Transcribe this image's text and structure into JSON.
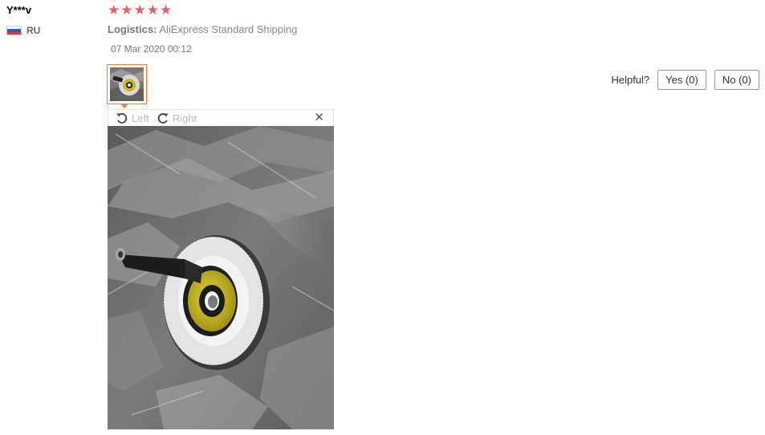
{
  "review": {
    "user_name": "Y***v",
    "country_code": "RU",
    "stars": [
      "★",
      "★",
      "★",
      "★",
      "★"
    ],
    "rating": 5,
    "logistics_label": "Logistics:",
    "logistics_value": "AliExpress Standard Shipping",
    "date": "07 Mar 2020 00:12"
  },
  "viewer": {
    "rotate_left_label": "Left",
    "rotate_right_label": "Right",
    "close_glyph": "✕"
  },
  "helpful": {
    "question": "Helpful?",
    "yes_label": "Yes (0)",
    "no_label": "No (0)"
  },
  "colors": {
    "star": "#f05b5b",
    "thumb_border": "#f37b2b"
  }
}
